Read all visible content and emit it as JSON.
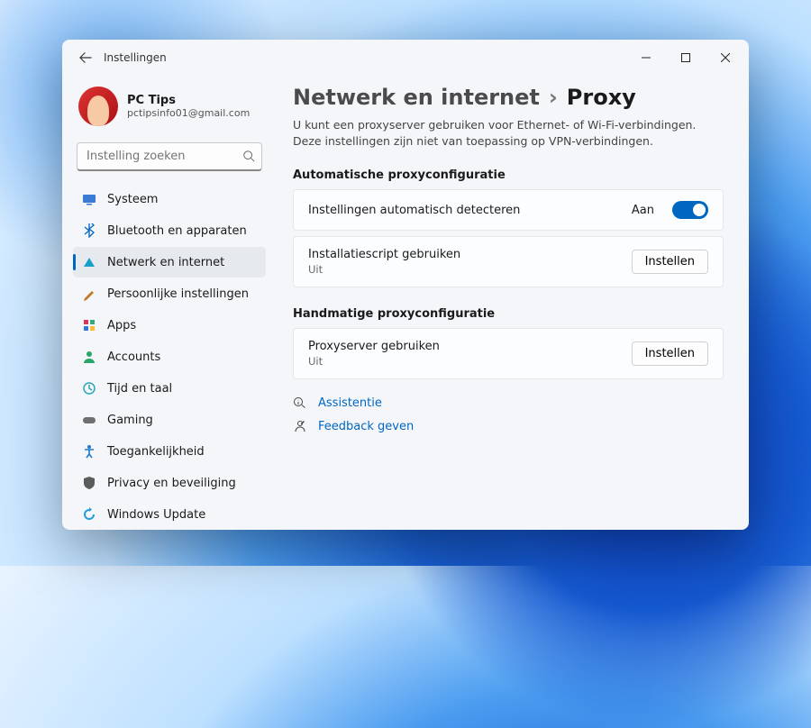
{
  "window": {
    "title": "Instellingen"
  },
  "profile": {
    "name": "PC Tips",
    "email": "pctipsinfo01@gmail.com"
  },
  "search": {
    "placeholder": "Instelling zoeken"
  },
  "sidebar": {
    "items": [
      {
        "label": "Systeem",
        "icon": "display-icon",
        "color": "#3a7bd5"
      },
      {
        "label": "Bluetooth en apparaten",
        "icon": "bluetooth-icon",
        "color": "#0067c0"
      },
      {
        "label": "Netwerk en internet",
        "icon": "wifi-icon",
        "color": "#18a0c9",
        "active": true
      },
      {
        "label": "Persoonlijke instellingen",
        "icon": "brush-icon",
        "color": "#c07a2a"
      },
      {
        "label": "Apps",
        "icon": "apps-icon",
        "color": "#6f6f6f"
      },
      {
        "label": "Accounts",
        "icon": "person-icon",
        "color": "#2aa56a"
      },
      {
        "label": "Tijd en taal",
        "icon": "clock-icon",
        "color": "#2aa5b5"
      },
      {
        "label": "Gaming",
        "icon": "gamepad-icon",
        "color": "#6f6f6f"
      },
      {
        "label": "Toegankelijkheid",
        "icon": "accessibility-icon",
        "color": "#1f7acb"
      },
      {
        "label": "Privacy en beveiliging",
        "icon": "shield-icon",
        "color": "#5b5b5b"
      },
      {
        "label": "Windows Update",
        "icon": "update-icon",
        "color": "#1f9cdd"
      }
    ]
  },
  "breadcrumb": {
    "parent": "Netwerk en internet",
    "current": "Proxy"
  },
  "description": "U kunt een proxyserver gebruiken voor Ethernet- of Wi-Fi-verbindingen. Deze instellingen zijn niet van toepassing op VPN-verbindingen.",
  "sections": {
    "auto": {
      "title": "Automatische proxyconfiguratie",
      "detect": {
        "label": "Instellingen automatisch detecteren",
        "state_label": "Aan"
      },
      "script": {
        "label": "Installatiescript gebruiken",
        "sub": "Uit",
        "button": "Instellen"
      }
    },
    "manual": {
      "title": "Handmatige proxyconfiguratie",
      "proxy": {
        "label": "Proxyserver gebruiken",
        "sub": "Uit",
        "button": "Instellen"
      }
    }
  },
  "links": {
    "help": "Assistentie",
    "feedback": "Feedback geven"
  }
}
